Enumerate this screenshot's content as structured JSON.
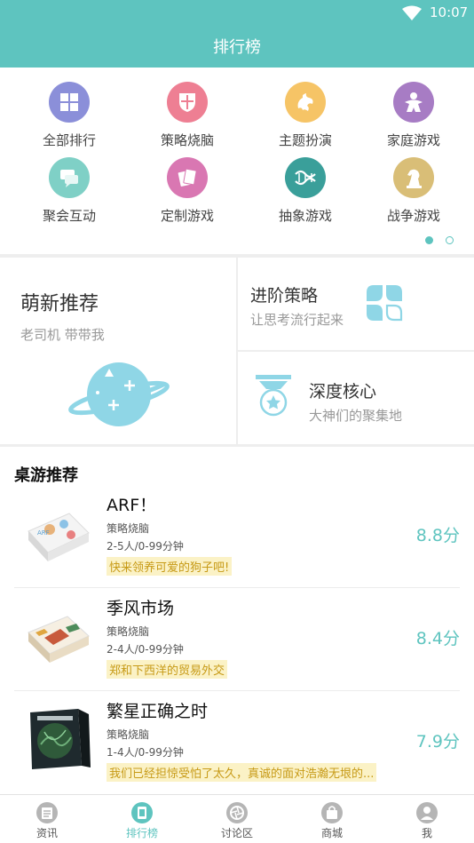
{
  "status": {
    "time": "10:07"
  },
  "header": {
    "title": "排行榜"
  },
  "categories": [
    {
      "label": "全部排行",
      "color": "#8b8fd9",
      "icon": "grid-icon"
    },
    {
      "label": "策略烧脑",
      "color": "#ee7f93",
      "icon": "shield-icon"
    },
    {
      "label": "主题扮演",
      "color": "#f6c466",
      "icon": "dragon-icon"
    },
    {
      "label": "家庭游戏",
      "color": "#a77cc4",
      "icon": "meeple-icon"
    },
    {
      "label": "聚会互动",
      "color": "#7fd0c6",
      "icon": "chat-icon"
    },
    {
      "label": "定制游戏",
      "color": "#d977b2",
      "icon": "cards-icon"
    },
    {
      "label": "抽象游戏",
      "color": "#3a9f9a",
      "icon": "dna-icon"
    },
    {
      "label": "战争游戏",
      "color": "#d9be77",
      "icon": "horse-icon"
    }
  ],
  "promo": {
    "newbie": {
      "title": "萌新推荐",
      "subtitle": "老司机 带带我"
    },
    "advanced": {
      "title": "进阶策略",
      "subtitle": "让思考流行起来"
    },
    "hardcore": {
      "title": "深度核心",
      "subtitle": "大神们的聚集地"
    }
  },
  "recommend": {
    "title": "桌游推荐",
    "games": [
      {
        "name": "ARF！",
        "genre": "策略烧脑",
        "players": "2-5人/0-99分钟",
        "tag": "快来领养可爱的狗子吧!",
        "score": "8.8分"
      },
      {
        "name": "季风市场",
        "genre": "策略烧脑",
        "players": "2-4人/0-99分钟",
        "tag": "郑和下西洋的贸易外交",
        "score": "8.4分"
      },
      {
        "name": "繁星正确之时",
        "genre": "策略烧脑",
        "players": "1-4人/0-99分钟",
        "tag": "我们已经担惊受怕了太久，真诚的面对浩瀚无垠的...",
        "score": "7.9分"
      }
    ]
  },
  "tabs": [
    {
      "label": "资讯",
      "icon": "news-icon"
    },
    {
      "label": "排行榜",
      "icon": "ranking-icon"
    },
    {
      "label": "讨论区",
      "icon": "discussion-icon"
    },
    {
      "label": "商城",
      "icon": "shop-icon"
    },
    {
      "label": "我",
      "icon": "profile-icon"
    }
  ],
  "colors": {
    "accent": "#5ec4bf",
    "tag_text": "#c79a16",
    "tag_bg": "#fbf2c6"
  }
}
